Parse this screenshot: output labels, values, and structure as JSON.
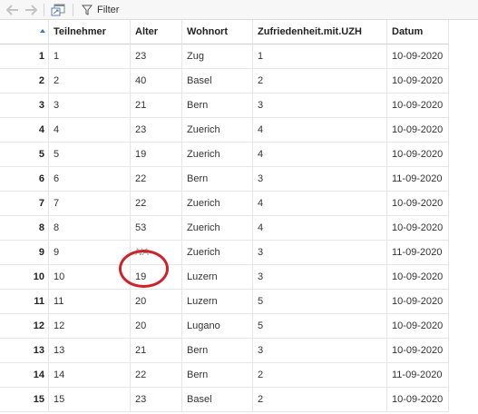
{
  "toolbar": {
    "back_icon": "arrow-left-icon",
    "forward_icon": "arrow-right-icon",
    "popout_icon": "window-popout-icon",
    "filter_icon": "funnel-icon",
    "filter_label": "Filter"
  },
  "table": {
    "columns": [
      "Teilnehmer",
      "Alter",
      "Wohnort",
      "Zufriedenheit.mit.UZH",
      "Datum"
    ],
    "sorted_column_index": -1,
    "rows": [
      {
        "n": "1",
        "cells": [
          "1",
          "23",
          "Zug",
          "1",
          "10-09-2020"
        ]
      },
      {
        "n": "2",
        "cells": [
          "2",
          "40",
          "Basel",
          "2",
          "10-09-2020"
        ]
      },
      {
        "n": "3",
        "cells": [
          "3",
          "21",
          "Bern",
          "3",
          "10-09-2020"
        ]
      },
      {
        "n": "4",
        "cells": [
          "4",
          "23",
          "Zuerich",
          "4",
          "10-09-2020"
        ]
      },
      {
        "n": "5",
        "cells": [
          "5",
          "19",
          "Zuerich",
          "4",
          "10-09-2020"
        ]
      },
      {
        "n": "6",
        "cells": [
          "6",
          "22",
          "Bern",
          "3",
          "11-09-2020"
        ]
      },
      {
        "n": "7",
        "cells": [
          "7",
          "22",
          "Zuerich",
          "4",
          "10-09-2020"
        ]
      },
      {
        "n": "8",
        "cells": [
          "8",
          "53",
          "Zuerich",
          "4",
          "10-09-2020"
        ]
      },
      {
        "n": "9",
        "cells": [
          "9",
          "NA",
          "Zuerich",
          "3",
          "11-09-2020"
        ]
      },
      {
        "n": "10",
        "cells": [
          "10",
          "19",
          "Luzern",
          "3",
          "10-09-2020"
        ]
      },
      {
        "n": "11",
        "cells": [
          "11",
          "20",
          "Luzern",
          "5",
          "10-09-2020"
        ]
      },
      {
        "n": "12",
        "cells": [
          "12",
          "20",
          "Lugano",
          "5",
          "10-09-2020"
        ]
      },
      {
        "n": "13",
        "cells": [
          "13",
          "21",
          "Bern",
          "3",
          "10-09-2020"
        ]
      },
      {
        "n": "14",
        "cells": [
          "14",
          "22",
          "Bern",
          "2",
          "11-09-2020"
        ]
      },
      {
        "n": "15",
        "cells": [
          "15",
          "23",
          "Basel",
          "2",
          "10-09-2020"
        ]
      }
    ]
  },
  "colors": {
    "annotation": "#d0202a",
    "na_text": "#9a9a9a",
    "sort_arrow": "#3a7abf"
  }
}
